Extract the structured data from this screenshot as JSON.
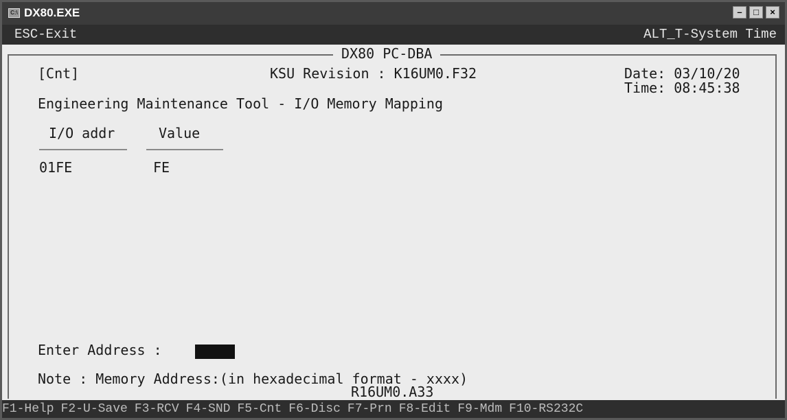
{
  "window": {
    "title": "DX80.EXE",
    "icon": "dos-console-icon"
  },
  "menu": {
    "exit": "ESC-Exit",
    "system_time": "ALT_T-System Time"
  },
  "header": {
    "frame_title": "DX80 PC-DBA",
    "mode": "[Cnt]",
    "ksu_revision": "KSU Revision : K16UM0.F32",
    "date": "Date: 03/10/20",
    "time": "Time: 08:45:38",
    "tool_title": "Engineering Maintenance Tool - I/O Memory Mapping"
  },
  "table": {
    "headers": [
      "I/O addr",
      "Value"
    ],
    "rows": [
      {
        "addr": "01FE",
        "value": "FE"
      }
    ]
  },
  "prompt": {
    "label": "Enter Address :",
    "value": ""
  },
  "note": "Note : Memory Address:(in hexadecimal format - xxxx)",
  "footer_version": "R16UM0.A33",
  "fkeys": [
    "F1-Help",
    "F2-U-Save",
    "F3-RCV",
    "F4-SND",
    "F5-Cnt",
    "F6-Disc",
    "F7-Prn",
    "F8-Edit",
    "F9-Mdm",
    "F10-RS232C"
  ]
}
